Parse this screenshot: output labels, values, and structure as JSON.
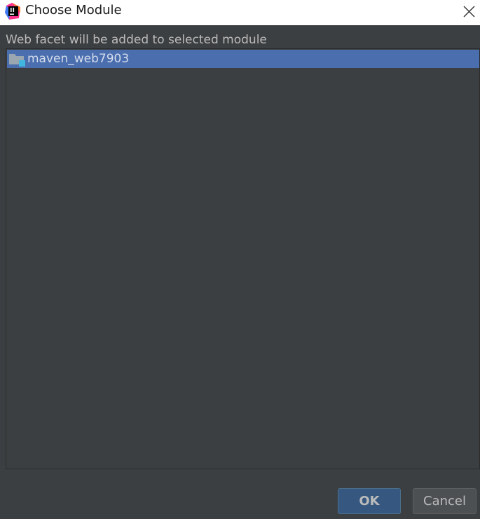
{
  "window": {
    "title": "Choose Module",
    "app_icon": "intellij-idea-icon",
    "close_icon": "close-icon"
  },
  "dialog": {
    "description": "Web facet will be added to selected module"
  },
  "modules": [
    {
      "name": "maven_web7903",
      "icon": "module-folder-icon",
      "selected": true
    }
  ],
  "buttons": {
    "ok_label": "OK",
    "cancel_label": "Cancel"
  },
  "colors": {
    "background": "#3c3f41",
    "selection": "#4b6eaf",
    "text": "#bbbbbb",
    "ok_button": "#365880",
    "cancel_button": "#4c5052"
  }
}
